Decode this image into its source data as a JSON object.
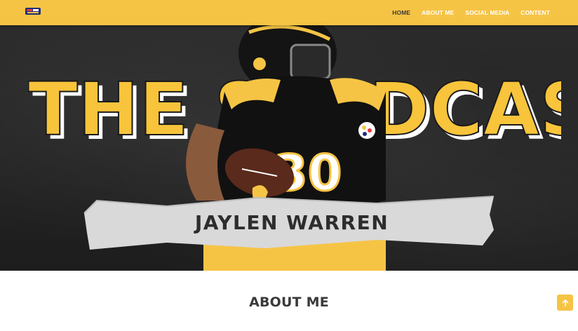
{
  "nav": {
    "links": [
      {
        "label": "HOME",
        "active": true
      },
      {
        "label": "ABOUT ME",
        "active": false
      },
      {
        "label": "SOCIAL MEDIA",
        "active": false
      },
      {
        "label": "CONTENT",
        "active": false
      }
    ]
  },
  "hero": {
    "title_left": "THE SI",
    "title_right": "DCAST",
    "player_name": "JAYLEN WARREN",
    "jersey_number": "30"
  },
  "about": {
    "heading": "ABOUT ME"
  },
  "colors": {
    "brand_yellow": "#f6c445",
    "title_yellow": "#f7c43b",
    "hero_dark": "#262626",
    "heading_text": "#3a3a3a"
  },
  "icons": {
    "scroll_top": "arrow-up-icon"
  }
}
